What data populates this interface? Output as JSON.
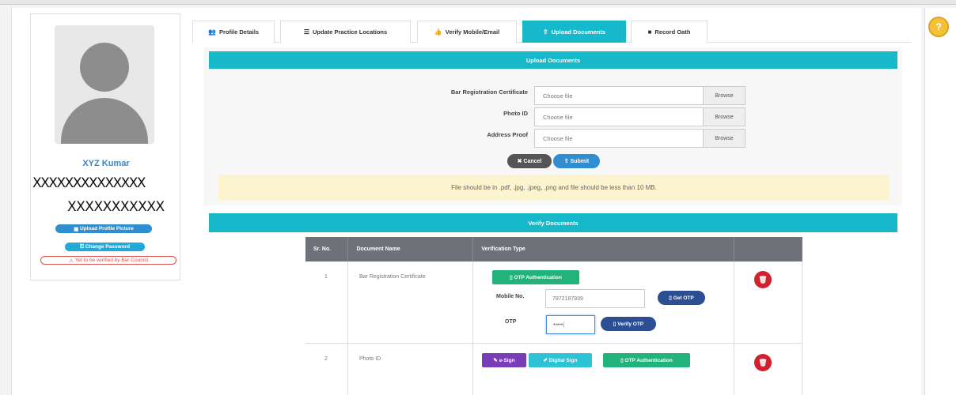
{
  "profile": {
    "name": "XYZ Kumar",
    "masked_line1": "XXXXXXXXXXXXXX",
    "masked_line2": "XXXXXXXXXXX",
    "upload_picture": "Upload Profile Picture",
    "change_password": "Change Password",
    "warning": "Yet to be verified by Bar Council"
  },
  "tabs": [
    {
      "label": "Profile Details",
      "icon": "user-icon"
    },
    {
      "label": "Update Practice Locations",
      "icon": "list-icon"
    },
    {
      "label": "Verify Mobile/Email",
      "icon": "thumbs-up-icon"
    },
    {
      "label": "Upload Documents",
      "icon": "upload-icon",
      "active": true
    },
    {
      "label": "Record Oath",
      "icon": "video-icon"
    }
  ],
  "upload": {
    "title": "Upload Documents",
    "fields": [
      {
        "label": "Bar Registration Certificate",
        "placeholder": "Choose file",
        "browse": "Browse"
      },
      {
        "label": "Photo ID",
        "placeholder": "Choose file",
        "browse": "Browse"
      },
      {
        "label": "Address Proof",
        "placeholder": "Choose file",
        "browse": "Browse"
      }
    ],
    "cancel": "Cancel",
    "submit": "Submit",
    "note": "File should be in .pdf, .jpg, .jpeg, .png and file should be less than 10 MB."
  },
  "verify": {
    "title": "Verify Documents",
    "columns": [
      "Sr. No.",
      "Document Name",
      "Verification Type",
      ""
    ],
    "rows": [
      {
        "sr": "1",
        "name": "Bar Registration Certificate",
        "otp_auth": "OTP Authentication",
        "mobile_label": "Mobile No.",
        "mobile_value": "7972187939",
        "get_otp": "Get OTP",
        "otp_label": "OTP",
        "otp_value": "•••••|",
        "verify_otp": "Verify OTP"
      },
      {
        "sr": "2",
        "name": "Photo ID",
        "esign": "e-Sign",
        "digital_sign": "Digital Sign",
        "otp_auth": "OTP Authentication"
      }
    ]
  },
  "colors": {
    "accent": "#17b8c9",
    "delete": "#d0212f",
    "otp": "#21b37a"
  }
}
